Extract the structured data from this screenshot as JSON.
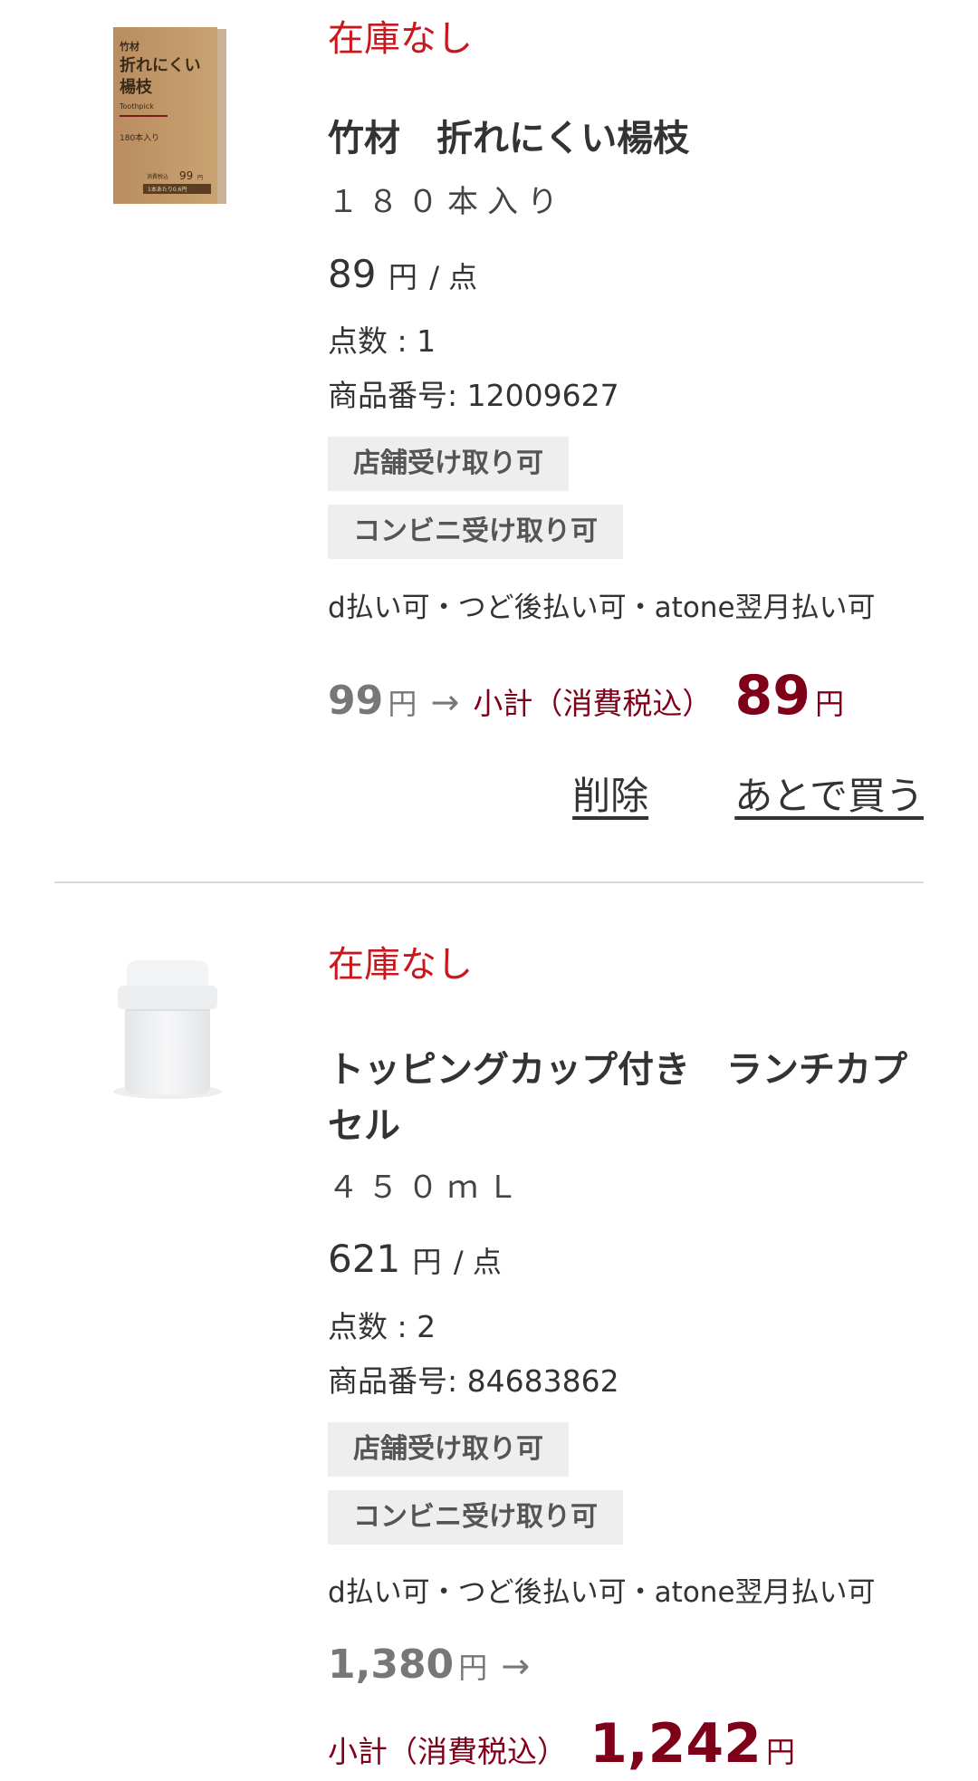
{
  "items": [
    {
      "stock_status": "在庫なし",
      "name": "竹材　折れにくい楊枝",
      "variant": "１８０本入り",
      "unit_price": "89",
      "unit_suffix": "円",
      "per_unit": "/ 点",
      "qty_label": "点数 :",
      "qty": "1",
      "code_label": "商品番号:",
      "code": "12009627",
      "tags": [
        "店舗受け取り可",
        "コンビニ受け取り可"
      ],
      "payments": "d払い可・つど後払い可・atone翌月払い可",
      "original_price": "99",
      "yen": "円",
      "arrow": "→",
      "subtotal_label": "小計（消費税込）",
      "subtotal": "89",
      "delete_label": "削除",
      "later_label": "あとで買う",
      "thumb": {
        "box_line1": "竹材",
        "box_line2": "折れにくい",
        "box_line3": "楊枝",
        "box_en": "Toothpick",
        "box_count": "180本入り",
        "box_price_label": "消費税込",
        "box_price": "99",
        "box_price_yen": "円",
        "box_unit": "1本あたり0.6円"
      }
    },
    {
      "stock_status": "在庫なし",
      "name": "トッピングカップ付き　ランチカプセル",
      "variant": "４５０ｍＬ",
      "unit_price": "621",
      "unit_suffix": "円",
      "per_unit": "/ 点",
      "qty_label": "点数 :",
      "qty": "2",
      "code_label": "商品番号:",
      "code": "84683862",
      "tags": [
        "店舗受け取り可",
        "コンビニ受け取り可"
      ],
      "payments": "d払い可・つど後払い可・atone翌月払い可",
      "original_price": "1,380",
      "yen": "円",
      "arrow": "→",
      "subtotal_label": "小計（消費税込）",
      "subtotal": "1,242"
    }
  ],
  "colors": {
    "stock_red": "#c9171e",
    "subtotal_maroon": "#7f0019",
    "tag_bg": "#eeeeee",
    "kraft": "#c49a6c"
  }
}
